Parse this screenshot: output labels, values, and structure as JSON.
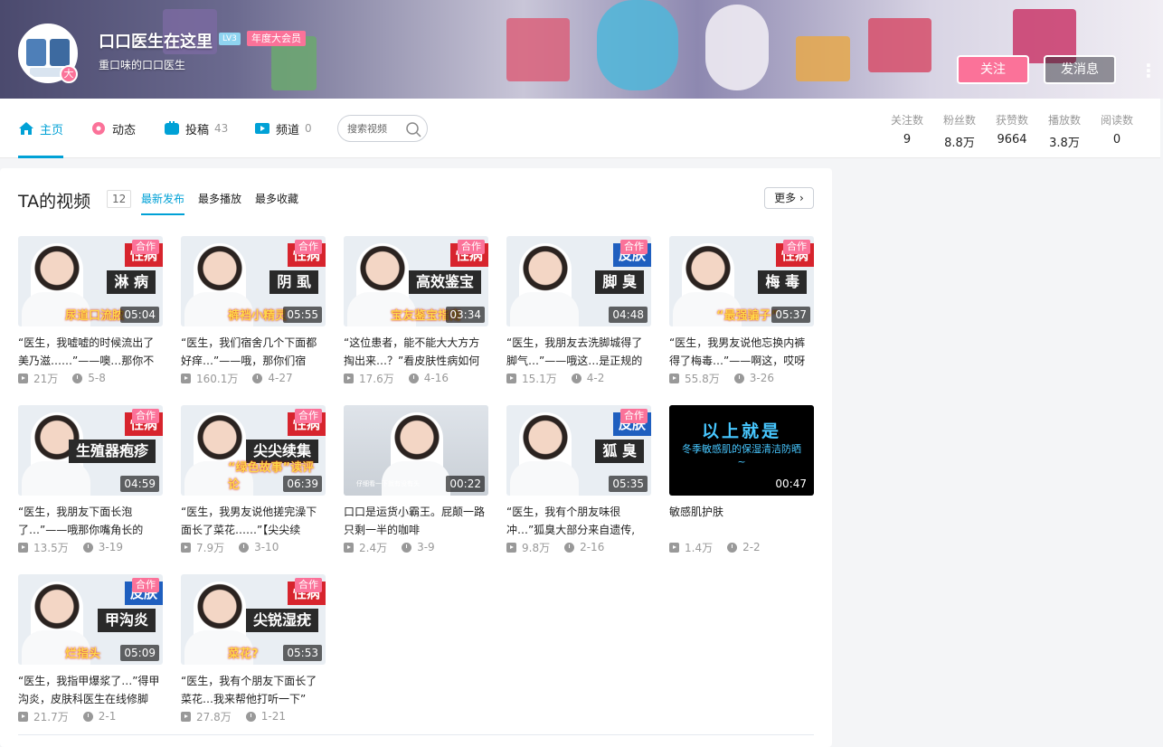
{
  "user": {
    "name": "口口医生在这里",
    "level": "LV3",
    "vip": "年度大会员",
    "sign": "重口味的口口医生",
    "avatar_badge": "大"
  },
  "actions": {
    "follow": "关注",
    "message": "发消息",
    "more": "⋮"
  },
  "nav": {
    "items": [
      {
        "label": "主页",
        "count": "",
        "icon": "home-icon",
        "color": "#00a1d6"
      },
      {
        "label": "动态",
        "count": "",
        "icon": "flower-icon",
        "color": "#fb7299"
      },
      {
        "label": "投稿",
        "count": "43",
        "icon": "tv-icon",
        "color": "#00a1d6"
      },
      {
        "label": "频道",
        "count": "0",
        "icon": "channel-icon",
        "color": "#00a1d6"
      }
    ],
    "search_placeholder": "搜索视频"
  },
  "stats": [
    {
      "label": "关注数",
      "value": "9"
    },
    {
      "label": "粉丝数",
      "value": "8.8万"
    },
    {
      "label": "获赞数",
      "value": "9664"
    },
    {
      "label": "播放数",
      "value": "3.8万"
    },
    {
      "label": "阅读数",
      "value": "0"
    }
  ],
  "videos_section": {
    "title": "TA的视频",
    "count": "12",
    "tabs": [
      "最新发布",
      "最多播放",
      "最多收藏"
    ],
    "more": "更多"
  },
  "videos": [
    {
      "line1": "性病",
      "line2": "淋 病",
      "sub": "尿道口流脓",
      "coop": "合作",
      "dur": "05:04",
      "title": "“医生，我嘘嘘的时候流出了美乃滋……”——噢…那你不",
      "plays": "21万",
      "date": "5-8",
      "tag": "#d7242d"
    },
    {
      "line1": "性病",
      "line2": "阴 虱",
      "sub": "裤裆小精灵",
      "coop": "合作",
      "dur": "05:55",
      "title": "“医生，我们宿舍几个下面都好痒…”——哦，那你们宿",
      "plays": "160.1万",
      "date": "4-27",
      "tag": "#d7242d"
    },
    {
      "line1": "性病",
      "line2": "高效鉴宝",
      "sub": "宝友鉴宝指南",
      "coop": "合作",
      "dur": "03:34",
      "title": "“这位患者，能不能大大方方掏出来…？”看皮肤性病如何",
      "plays": "17.6万",
      "date": "4-16",
      "tag": "#d7242d"
    },
    {
      "line1": "皮肤",
      "line2": "脚 臭",
      "sub": "",
      "coop": "合作",
      "dur": "04:48",
      "title": "“医生，我朋友去洗脚城得了脚气…”——哦这…是正规的",
      "plays": "15.1万",
      "date": "4-2",
      "tag": "#1f5fbf"
    },
    {
      "line1": "性病",
      "line2": "梅 毒",
      "sub": "“最强骗子”",
      "coop": "合作",
      "dur": "05:37",
      "title": "“医生，我男友说他忘换内裤得了梅毒…”——啊这，哎呀",
      "plays": "55.8万",
      "date": "3-26",
      "tag": "#d7242d"
    },
    {
      "line1": "性病",
      "line2": "生殖器疱疹",
      "sub": "",
      "coop": "合作",
      "dur": "04:59",
      "title": "“医生，我朋友下面长泡了…”——哦那你嘴角长的",
      "plays": "13.5万",
      "date": "3-19",
      "tag": "#d7242d"
    },
    {
      "line1": "性病",
      "line2": "尖尖续集",
      "sub": "“绿色故事”读评论",
      "coop": "合作",
      "dur": "06:39",
      "title": "“医生，我男友说他搓完澡下面长了菜花……”【尖尖续",
      "plays": "7.9万",
      "date": "3-10",
      "tag": "#d7242d"
    },
    {
      "line1": "",
      "line2": "",
      "sub": "仔细看一下就有没有头",
      "coop": "",
      "dur": "00:22",
      "title": "口口是运货小霸王。屁颠一路只剩一半的咖啡",
      "plays": "2.4万",
      "date": "3-9",
      "tag": "#999"
    },
    {
      "line1": "皮肤",
      "line2": "狐 臭",
      "sub": "",
      "coop": "合作",
      "dur": "05:35",
      "title": "“医生，我有个朋友味很冲…”狐臭大部分来自遗传,",
      "plays": "9.8万",
      "date": "2-16",
      "tag": "#1f5fbf"
    },
    {
      "line1": "以上就是",
      "line2": "冬季敏感肌的保湿清洁防晒~",
      "sub": "",
      "coop": "",
      "dur": "00:47",
      "title": "敏感肌护肤",
      "plays": "1.4万",
      "date": "2-2",
      "tag": "#000"
    },
    {
      "line1": "皮肤",
      "line2": "甲沟炎",
      "sub": "烂指头",
      "coop": "合作",
      "dur": "05:09",
      "title": "“医生，我指甲爆浆了…”得甲沟炎，皮肤科医生在线修脚",
      "plays": "21.7万",
      "date": "2-1",
      "tag": "#1f5fbf"
    },
    {
      "line1": "性病",
      "line2": "尖锐湿疣",
      "sub": "菜花?",
      "coop": "合作",
      "dur": "05:53",
      "title": "“医生，我有个朋友下面长了菜花…我来帮他打听一下”",
      "plays": "27.8万",
      "date": "1-21",
      "tag": "#d7242d"
    }
  ]
}
